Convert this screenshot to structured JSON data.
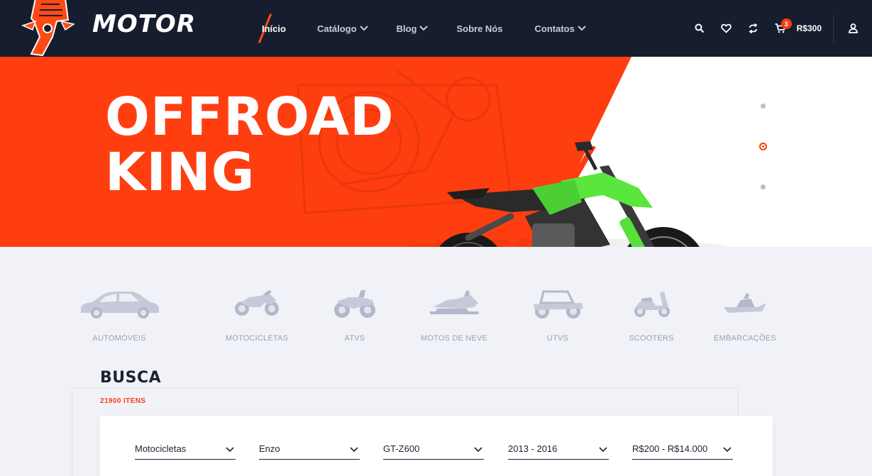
{
  "brand": {
    "name": "MOTOR"
  },
  "nav": {
    "items": [
      {
        "label": "Início",
        "active": true,
        "dropdown": false
      },
      {
        "label": "Catálogo",
        "active": false,
        "dropdown": true
      },
      {
        "label": "Blog",
        "active": false,
        "dropdown": true
      },
      {
        "label": "Sobre Nós",
        "active": false,
        "dropdown": false
      },
      {
        "label": "Contatos",
        "active": false,
        "dropdown": true
      }
    ]
  },
  "tools": {
    "icons": [
      "search-icon",
      "heart-icon",
      "compare-icon",
      "cart-icon",
      "user-icon"
    ],
    "cart_count": "3",
    "cart_total": "R$300"
  },
  "hero": {
    "line1": "OFFROAD",
    "line2": "KING",
    "slides_count": 3,
    "active_slide": 2,
    "accent_color": "#ff3b12"
  },
  "categories": [
    {
      "label": "AUTOMÓVEIS",
      "icon": "car-icon"
    },
    {
      "label": "MOTOCICLETAS",
      "icon": "motorcycle-icon"
    },
    {
      "label": "ATVS",
      "icon": "atv-icon"
    },
    {
      "label": "MOTOS DE NEVE",
      "icon": "snowmobile-icon"
    },
    {
      "label": "UTVS",
      "icon": "utv-icon"
    },
    {
      "label": "SCOOTERS",
      "icon": "scooter-icon"
    },
    {
      "label": "EMBARCAÇÕES",
      "icon": "boat-icon"
    }
  ],
  "search": {
    "title": "BUSCA",
    "count": "21900 ITENS",
    "filters": [
      {
        "value": "Motocicletas"
      },
      {
        "value": "Enzo"
      },
      {
        "value": "GT-Z600"
      },
      {
        "value": "2013 - 2016"
      },
      {
        "value": "R$200 - R$14.000"
      }
    ]
  },
  "colors": {
    "header_bg": "#161d2e",
    "accent": "#ff3b12",
    "page_bg": "#f1f2f7"
  }
}
